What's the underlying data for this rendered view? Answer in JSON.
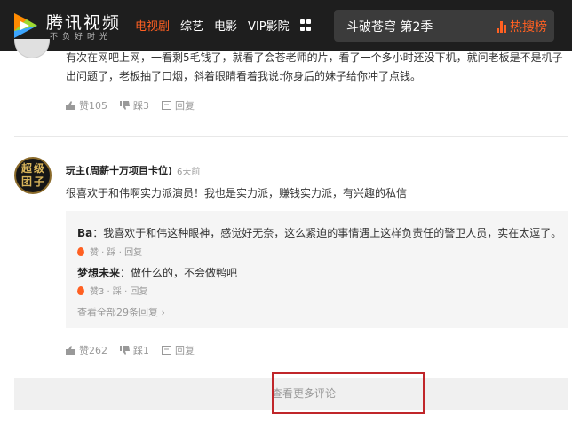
{
  "header": {
    "logo_title": "腾讯视频",
    "logo_slogan": "不负好时光",
    "nav": [
      {
        "label": "电视剧",
        "active": true
      },
      {
        "label": "综艺",
        "active": false
      },
      {
        "label": "电影",
        "active": false
      },
      {
        "label": "VIP影院",
        "active": false
      }
    ],
    "search_value": "斗破苍穹 第2季",
    "hot_label": "热搜榜",
    "accent_color": "#ff6022"
  },
  "comments": [
    {
      "text": "有次在网吧上网，一看剩5毛钱了，就看了会苍老师的片，看了一个多小时还没下机，就问老板是不是机子出问题了，老板抽了口烟，斜着眼睛看着我说:你身后的妹子给你冲了点钱。",
      "likes": "赞105",
      "dislikes": "踩3",
      "reply_label": "回复"
    },
    {
      "avatar_text": "超级团子",
      "name": "玩主(周薪十万项目卡位)",
      "time": "6天前",
      "text": "很喜欢于和伟啊实力派演员！我也是实力派，赚钱实力派，有兴趣的私信",
      "likes": "赞262",
      "dislikes": "踩1",
      "reply_label": "回复",
      "replies": [
        {
          "author": "Ba",
          "text": "：我喜欢于和伟这种眼神，感觉好无奈，这么紧迫的事情遇上这样负责任的警卫人员，实在太逗了。",
          "actions": "赞 · 踩 · 回复"
        },
        {
          "author": "梦想未来",
          "text": "：做什么的，不会做鸭吧",
          "actions": "赞3 · 踩 · 回复"
        }
      ],
      "view_all": "查看全部29条回复"
    }
  ],
  "load_more_label": "查看更多评论",
  "highlight_color": "#c0262a"
}
